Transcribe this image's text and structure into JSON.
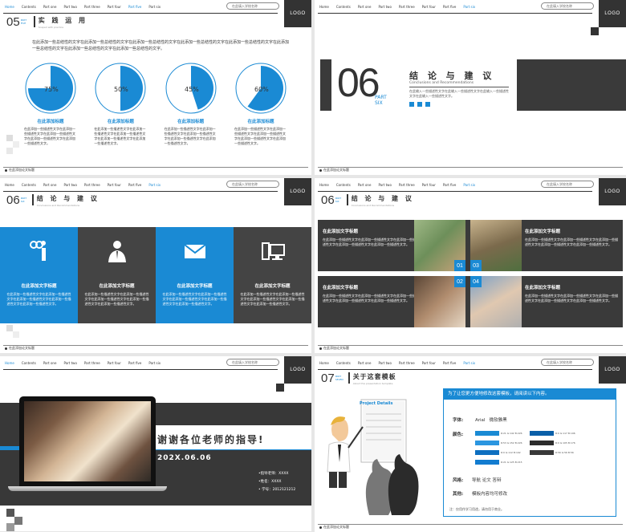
{
  "nav": {
    "items": [
      "Home",
      "Contents",
      "Part one",
      "Part two",
      "Part three",
      "Part four",
      "Part five",
      "Part six"
    ],
    "search_placeholder": "在此填入学校名称",
    "logo": "LOGO",
    "footer": "在此添加论文标题"
  },
  "slide1": {
    "num": "05",
    "part": "PART FIVE",
    "title": "实 践 运 用",
    "subtitle": "Scaped with practice",
    "intro": "在此添加一些总结性的文字在此添加一些总结性的文字在此添加一些总结性的文字在此添加一些总结性的文字在此添加一些总结性的文字在此添加一些总结性的文字在此添加一些总结性的文字在此添加一些总结性的文字。",
    "pies": [
      {
        "label": "75%",
        "value": 75,
        "title": "在此添加标题",
        "text": "在此添加一些描述性文字在此添加一些描述性文字在此添加一些描述性文字在此添加一些描述性文字在此添加一些描述性文字。"
      },
      {
        "label": "50%",
        "value": 50,
        "title": "在此添加标题",
        "text": "在此添加一些描述性文字在此添加一些描述性文字在此添加一些描述性文字在此添加一些描述性文字在此添加一些描述性文字。"
      },
      {
        "label": "45%",
        "value": 45,
        "title": "在此添加标题",
        "text": "在此添加一些描述性文字在此添加一些描述性文字在此添加一些描述性文字在此添加一些描述性文字在此添加一些描述性文字。"
      },
      {
        "label": "60%",
        "value": 60,
        "title": "在此添加标题",
        "text": "在此添加一些描述性文字在此添加一些描述性文字在此添加一些描述性文字在此添加一些描述性文字在此添加一些描述性文字。"
      }
    ]
  },
  "slide2": {
    "num": "06",
    "part": "PART\nSIX",
    "title": "结 论 与 建 议",
    "subtitle": "Conclusions and Recommendations",
    "desc": "在此输入一些描述性文字在此输入一些描述性文字在此输入一些描述性文字在此输入一些描述性文字。"
  },
  "slide3": {
    "num": "06",
    "part": "PART SIX",
    "title": "结 论 与 建 议",
    "subtitle": "Conclusions and Recommendations",
    "panels": [
      {
        "icon": "handshake-icon",
        "title": "在此添加文字标题",
        "text": "在此添加一些描述性文字在此添加一些描述性文字在此添加一些描述性文字在此添加一些描述性文字在此添加一些描述性文字。"
      },
      {
        "icon": "businessman-icon",
        "title": "在此添加文字标题",
        "text": "在此添加一些描述性文字在此添加一些描述性文字在此添加一些描述性文字在此添加一些描述性文字在此添加一些描述性文字。"
      },
      {
        "icon": "envelope-icon",
        "title": "在此添加文字标题",
        "text": "在此添加一些描述性文字在此添加一些描述性文字在此添加一些描述性文字在此添加一些描述性文字在此添加一些描述性文字。"
      },
      {
        "icon": "computer-icon",
        "title": "在此添加文字标题",
        "text": "在此添加一些描述性文字在此添加一些描述性文字在此添加一些描述性文字在此添加一些描述性文字在此添加一些描述性文字。"
      }
    ]
  },
  "slide4": {
    "num": "06",
    "part": "PART SIX",
    "title": "结 论 与 建 议",
    "subtitle": "Conclusions and Recommendations",
    "items": [
      {
        "num": "01",
        "title": "在此添加文字标题",
        "text": "在此添加一些描述性文字在此添加一些描述性文字在此添加一些描述性文字在此添加一些描述性文字在此添加一些描述性文字。"
      },
      {
        "num": "03",
        "title": "在此添加文字标题",
        "text": "在此添加一些描述性文字在此添加一些描述性文字在此添加一些描述性文字在此添加一些描述性文字在此添加一些描述性文字。"
      },
      {
        "num": "02",
        "title": "在此添加文字标题",
        "text": "在此添加一些描述性文字在此添加一些描述性文字在此添加一些描述性文字在此添加一些描述性文字在此添加一些描述性文字。"
      },
      {
        "num": "04",
        "title": "在此添加文字标题",
        "text": "在此添加一些描述性文字在此添加一些描述性文字在此添加一些描述性文字在此添加一些描述性文字在此添加一些描述性文字。"
      }
    ]
  },
  "slide5": {
    "thanks": "谢谢各位老师的指导!",
    "date": "202X.06.06",
    "advisor": "•指导老师：XXXX",
    "name": "•姓名：XXXX",
    "id": "• 学号：2012121212"
  },
  "slide6": {
    "num": "07",
    "part": "PART SEVEN",
    "title": "关于这套模板",
    "subtitle": "About this presentation template",
    "board": "Project Details",
    "banner": "为了让您更方便地修改这套模板，请阅读以下内容。",
    "font_label": "字体:",
    "font_value": "Arial   微软雅黑",
    "color_label": "颜色:",
    "swatches": [
      {
        "color": "#1a8ad4",
        "code": "R:21 G:142 B:226"
      },
      {
        "color": "#2b96e0",
        "code": "R:53 G:152 B:226"
      },
      {
        "color": "#0d6fc0",
        "code": "R:0 G:112 B:192"
      },
      {
        "color": "#127cd0",
        "code": "R:21 G:125 B:215"
      },
      {
        "color": "#0a5fa8",
        "code": "R:0 G:117 B:196"
      },
      {
        "color": "#2c2c2c",
        "code": "R:0 G:105 B:176"
      },
      {
        "color": "#383838",
        "code": "R:56 G:56 B:56"
      }
    ],
    "style_label": "风格:",
    "style_value": "导航 论文 答辩",
    "other_label": "其他:",
    "other_value": "模板内容均可修改",
    "note": "注：仅用作学习用途，请勿用于商业。"
  },
  "colors": {
    "accent": "#1a8ad4",
    "dark": "#3a3a3a"
  }
}
